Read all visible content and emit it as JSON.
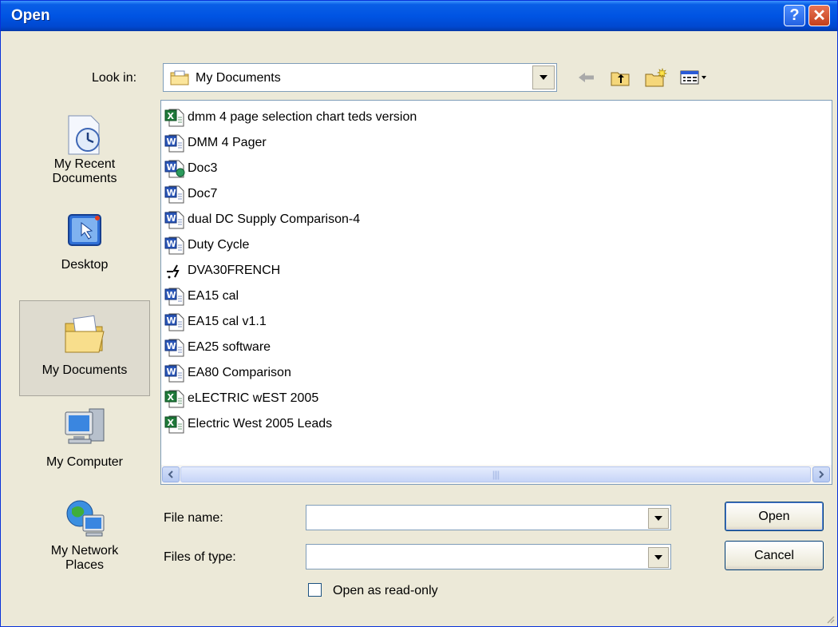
{
  "window": {
    "title": "Open",
    "help_symbol": "?",
    "close_symbol": "✕"
  },
  "look_in": {
    "label": "Look in:",
    "value": "My Documents"
  },
  "toolbar": {
    "icons": [
      "back-arrow-icon",
      "up-folder-icon",
      "new-folder-icon",
      "view-menu-icon"
    ]
  },
  "places": [
    {
      "label_1": "My Recent",
      "label_2": "Documents"
    },
    {
      "label_1": "Desktop",
      "label_2": ""
    },
    {
      "label_1": "My Documents",
      "label_2": ""
    },
    {
      "label_1": "My Computer",
      "label_2": ""
    },
    {
      "label_1": "My Network",
      "label_2": "Places"
    }
  ],
  "files": [
    {
      "name": "dmm 4 page selection chart teds version",
      "type": "excel"
    },
    {
      "name": "DMM 4 Pager",
      "type": "word"
    },
    {
      "name": "Doc3",
      "type": "word-linked"
    },
    {
      "name": "Doc7",
      "type": "word"
    },
    {
      "name": "dual DC Supply Comparison-4",
      "type": "word"
    },
    {
      "name": "Duty Cycle",
      "type": "word"
    },
    {
      "name": "DVA30FRENCH",
      "type": "shortcut"
    },
    {
      "name": "EA15 cal",
      "type": "word"
    },
    {
      "name": "EA15 cal v1.1",
      "type": "word"
    },
    {
      "name": "EA25 software",
      "type": "word"
    },
    {
      "name": "EA80 Comparison",
      "type": "word"
    },
    {
      "name": "eLECTRIC wEST 2005",
      "type": "excel"
    },
    {
      "name": "Electric West 2005 Leads",
      "type": "excel"
    }
  ],
  "file_name": {
    "label": "File name:",
    "value": ""
  },
  "files_of_type": {
    "label": "Files of type:",
    "value": ""
  },
  "buttons": {
    "open": "Open",
    "cancel": "Cancel"
  },
  "read_only": {
    "label": "Open as read-only",
    "checked": false
  },
  "colors": {
    "titlebar": "#0054e3",
    "face": "#ece9d8",
    "border": "#7f9db9"
  }
}
